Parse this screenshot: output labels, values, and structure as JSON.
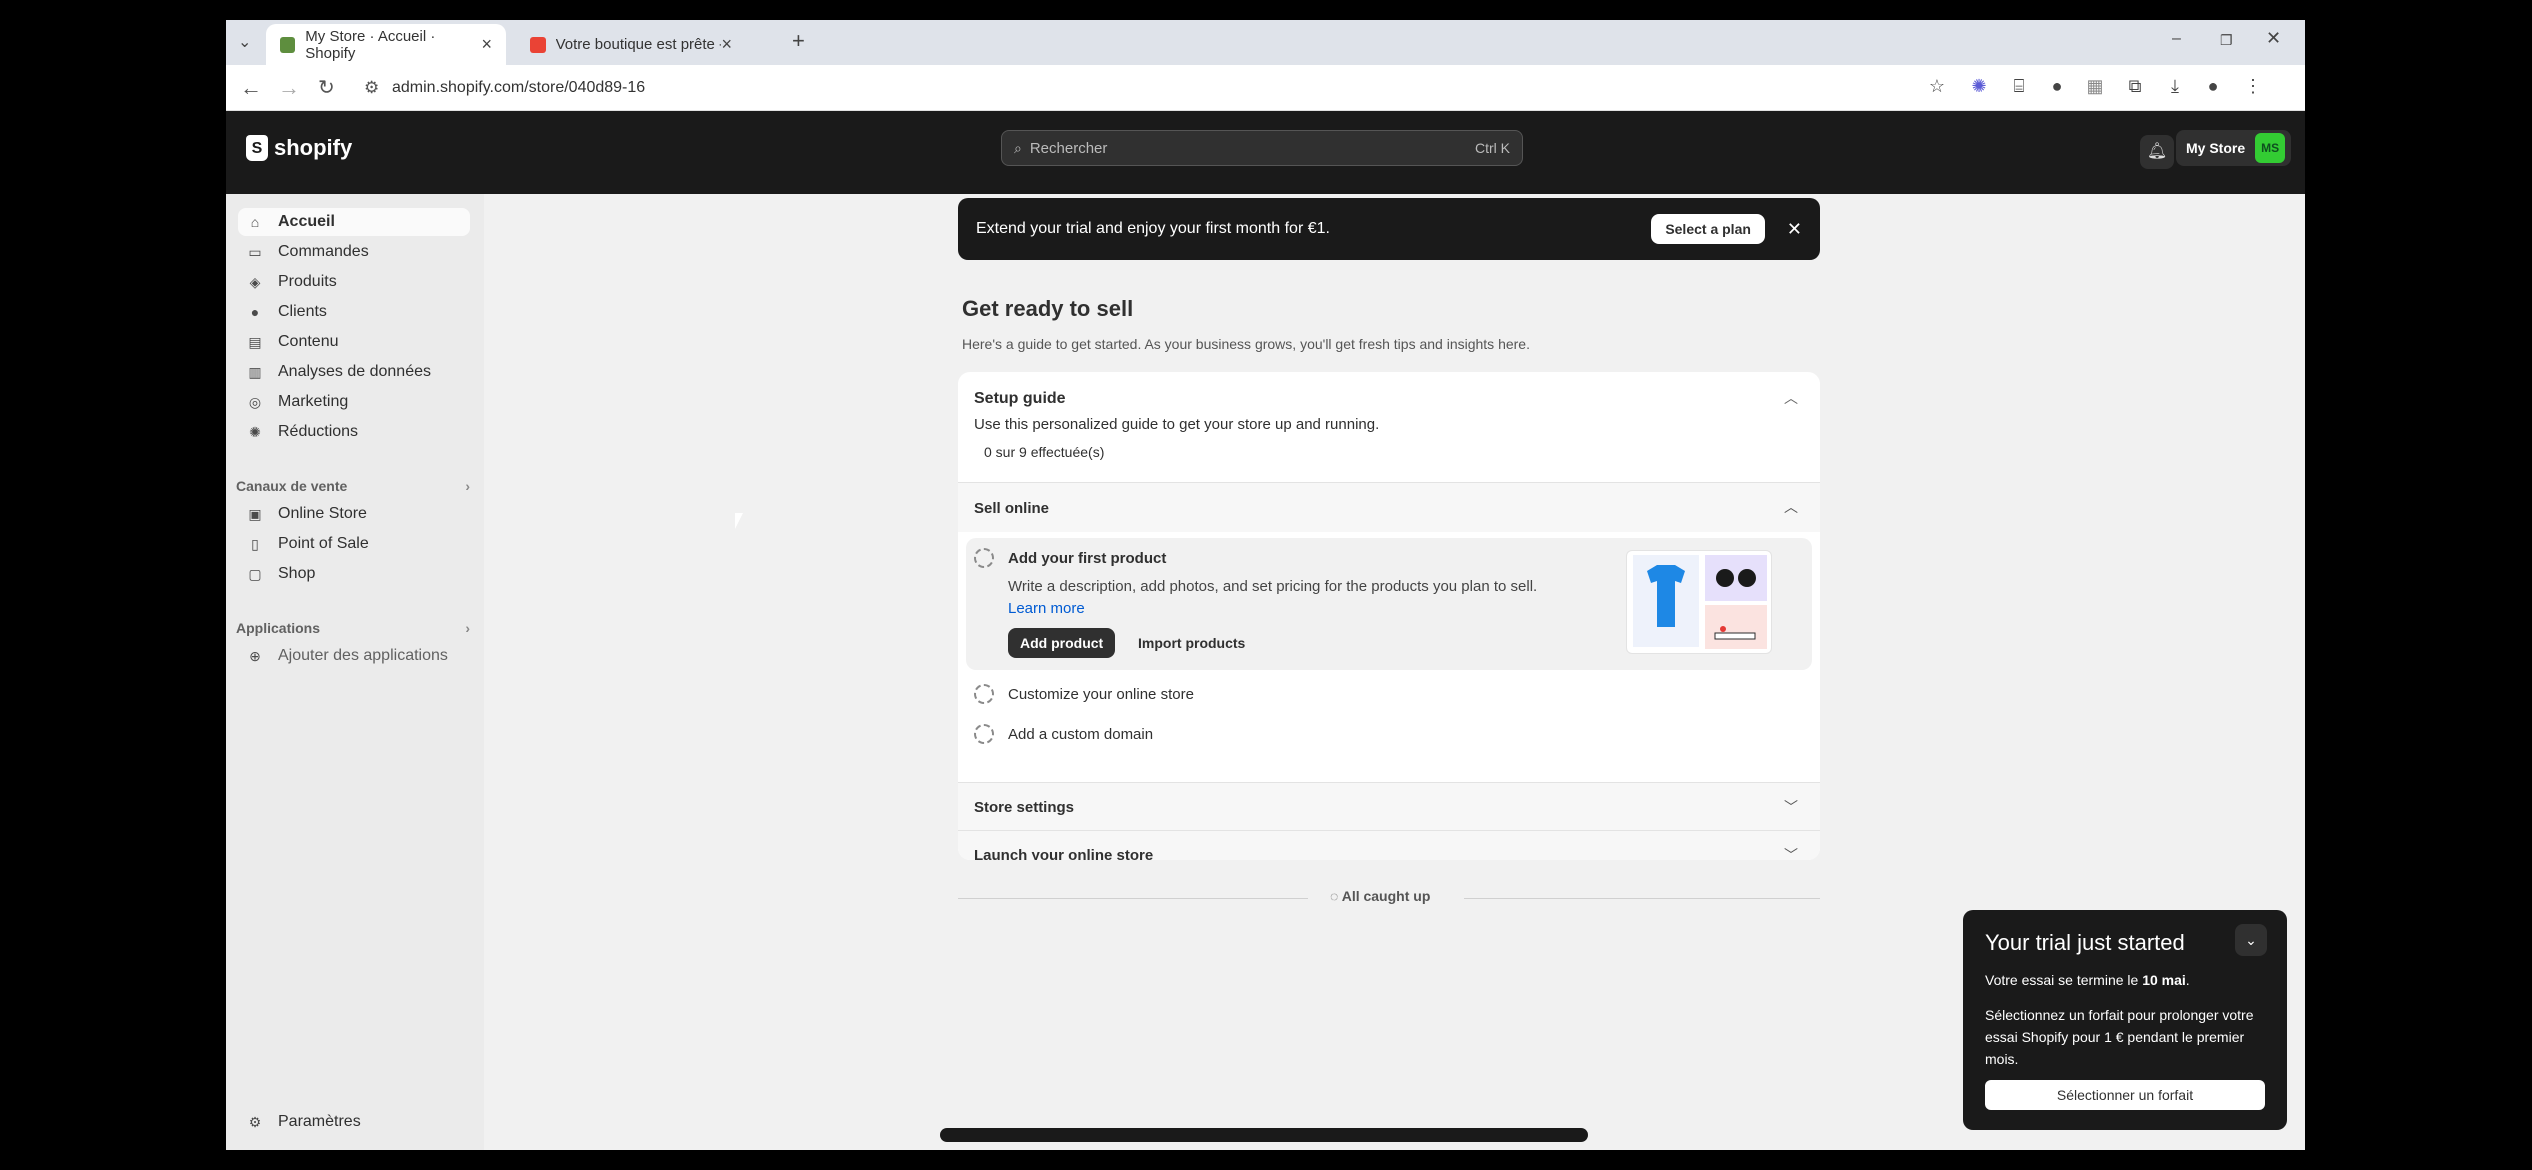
{
  "browser": {
    "tabs": [
      {
        "title": "My Store · Accueil · Shopify",
        "active": true
      },
      {
        "title": "Votre boutique est prête - eco...",
        "active": false
      }
    ],
    "url": "admin.shopify.com/store/040d89-16"
  },
  "topbar": {
    "logo_text": "shopify",
    "search_placeholder": "Rechercher",
    "search_shortcut": "Ctrl K",
    "store_name": "My Store",
    "avatar_initials": "MS",
    "avatar_color": "#33cc33"
  },
  "sidebar": {
    "items": [
      {
        "label": "Accueil",
        "icon": "home-icon",
        "active": true
      },
      {
        "label": "Commandes",
        "icon": "inbox-icon"
      },
      {
        "label": "Produits",
        "icon": "tag-icon"
      },
      {
        "label": "Clients",
        "icon": "person-icon"
      },
      {
        "label": "Contenu",
        "icon": "content-icon"
      },
      {
        "label": "Analyses de données",
        "icon": "chart-icon"
      },
      {
        "label": "Marketing",
        "icon": "target-icon"
      },
      {
        "label": "Réductions",
        "icon": "discount-icon"
      }
    ],
    "sales_channels": {
      "heading": "Canaux de vente",
      "items": [
        {
          "label": "Online Store",
          "icon": "store-icon"
        },
        {
          "label": "Point of Sale",
          "icon": "pos-icon"
        },
        {
          "label": "Shop",
          "icon": "shop-icon"
        }
      ]
    },
    "apps": {
      "heading": "Applications",
      "add_label": "Ajouter des applications"
    },
    "settings_label": "Paramètres"
  },
  "banner": {
    "text": "Extend your trial and enjoy your first month for €1.",
    "button": "Select a plan"
  },
  "page": {
    "title": "Get ready to sell",
    "subtitle": "Here's a guide to get started. As your business grows, you'll get fresh tips and insights here."
  },
  "setup_guide": {
    "title": "Setup guide",
    "description": "Use this personalized guide to get your store up and running.",
    "progress": "0 sur 9 effectuée(s)",
    "sections": [
      {
        "title": "Sell online",
        "tasks": [
          {
            "title": "Add your first product",
            "description": "Write a description, add photos, and set pricing for the products you plan to sell.",
            "link": "Learn more",
            "primary_button": "Add product",
            "secondary_button": "Import products"
          },
          {
            "title": "Customize your online store"
          },
          {
            "title": "Add a custom domain"
          }
        ]
      },
      {
        "title": "Store settings"
      },
      {
        "title": "Launch your online store"
      }
    ]
  },
  "caught_up": "All caught up",
  "trial_popup": {
    "title": "Your trial just started",
    "line1_prefix": "Votre essai se termine le ",
    "line1_date": "10 mai",
    "line1_suffix": ".",
    "line2": "Sélectionnez un forfait pour prolonger votre essai Shopify pour 1 € pendant le premier mois.",
    "button": "Sélectionner un forfait"
  }
}
